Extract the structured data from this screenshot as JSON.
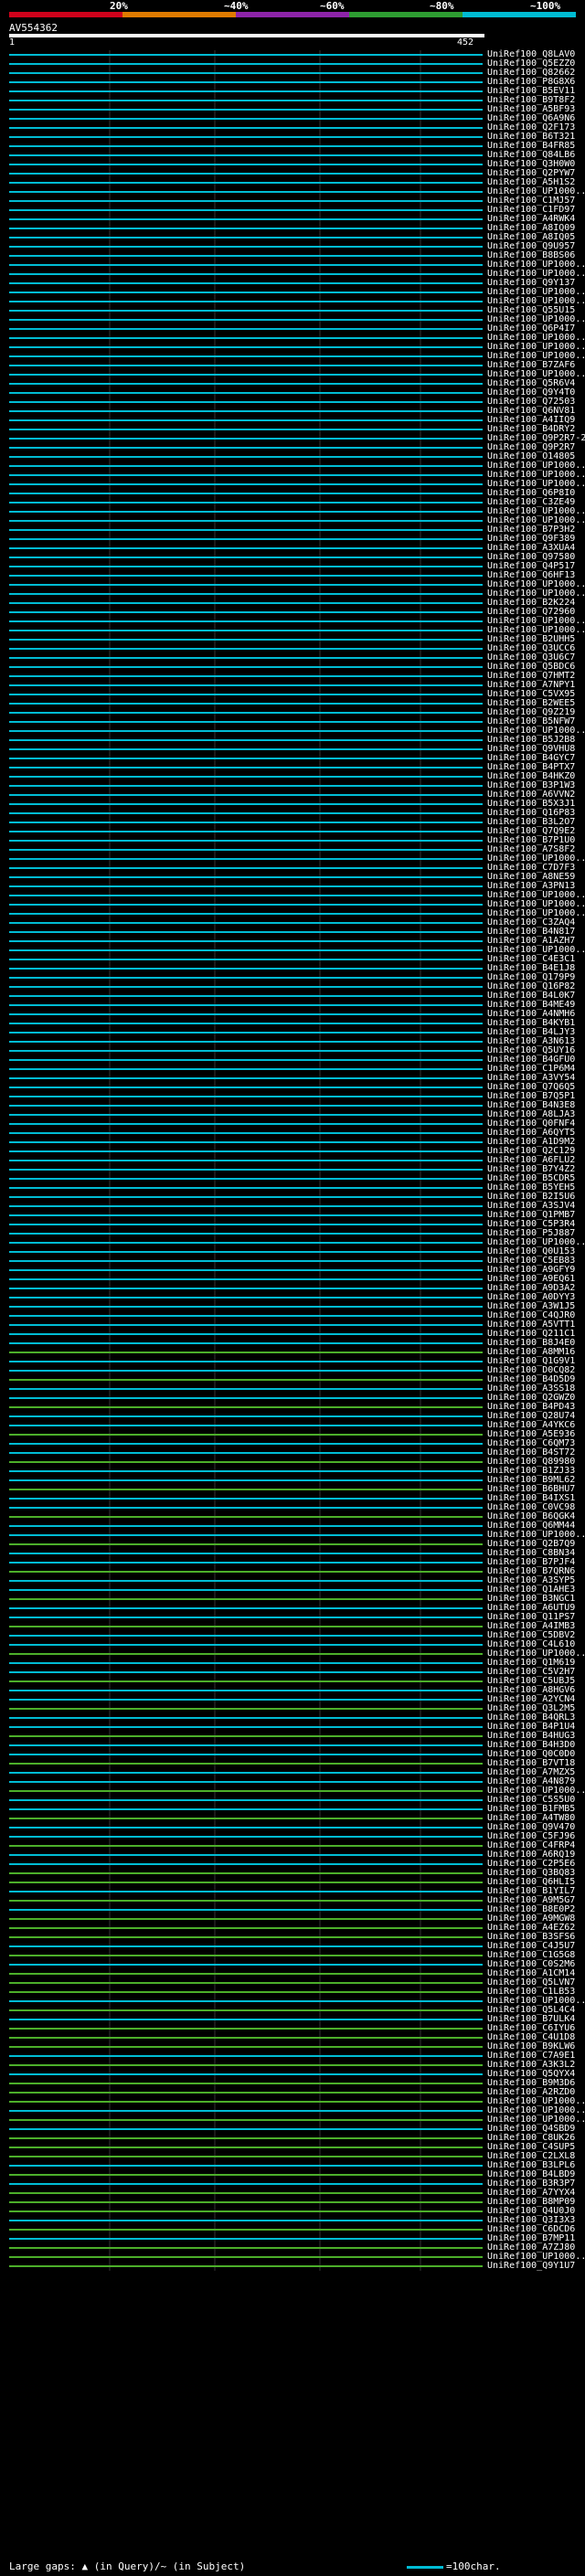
{
  "scale": {
    "labels": [
      "20%",
      "~40%",
      "~60%",
      "~80%",
      "~100%"
    ],
    "colors": [
      "#d0021b",
      "#e07b00",
      "#8e24aa",
      "#2e9e32",
      "#00bcd4"
    ]
  },
  "query": {
    "id": "AV554362",
    "start": "1",
    "end": "452"
  },
  "colors": {
    "cyan": "#00bcd4",
    "green": "#4caf2a",
    "query_line": "#ffffff"
  },
  "hits": [
    "UniRef100_Q8LAV0",
    "UniRef100_Q5EZZ0",
    "UniRef100_Q82662",
    "UniRef100_P8G8X6",
    "UniRef100_B5EV11",
    "UniRef100_B9T8F2",
    "UniRef100_A5BF93",
    "UniRef100_Q6A9N6",
    "UniRef100_Q2F173",
    "UniRef100_B6T321",
    "UniRef100_B4FR85",
    "UniRef100_Q84LB6",
    "UniRef100_Q3H0W0",
    "UniRef100_Q2PYW7",
    "UniRef100_A5H1S2",
    "UniRef100_UP1000...",
    "UniRef100_C1MJ57",
    "UniRef100_C1FD97",
    "UniRef100_A4RWK4",
    "UniRef100_A8IQ09",
    "UniRef100_A8IQ05",
    "UniRef100_Q9U957",
    "UniRef100_B8BS06",
    "UniRef100_UP1000...",
    "UniRef100_UP1000...",
    "UniRef100_Q9Y137",
    "UniRef100_UP1000...",
    "UniRef100_UP1000...",
    "UniRef100_Q55U15",
    "UniRef100_UP1000...",
    "UniRef100_Q6P4I7",
    "UniRef100_UP1000...",
    "UniRef100_UP1000...",
    "UniRef100_UP1000...",
    "UniRef100_B7ZAF6",
    "UniRef100_UP1000...",
    "UniRef100_Q5R6V4",
    "UniRef100_Q9Y4T0",
    "UniRef100_Q72503",
    "UniRef100_Q6NV81",
    "UniRef100_A4IIQ9",
    "UniRef100_B4DRY2",
    "UniRef100_Q9P2R7-2",
    "UniRef100_Q9P2R7",
    "UniRef100_O14805",
    "UniRef100_UP1000...",
    "UniRef100_UP1000...",
    "UniRef100_UP1000...",
    "UniRef100_Q6P8I0",
    "UniRef100_C3ZE49",
    "UniRef100_UP1000...",
    "UniRef100_UP1000...",
    "UniRef100_B7P3H2",
    "UniRef100_Q9F389",
    "UniRef100_A3XUA4",
    "UniRef100_Q97580",
    "UniRef100_Q4P517",
    "UniRef100_Q6HF13",
    "UniRef100_UP1000...",
    "UniRef100_UP1000...",
    "UniRef100_B2K224",
    "UniRef100_Q72960",
    "UniRef100_UP1000...",
    "UniRef100_UP1000...",
    "UniRef100_B2UHH5",
    "UniRef100_Q3UCC6",
    "UniRef100_Q3U6C7",
    "UniRef100_Q5BDC6",
    "UniRef100_Q7HMT2",
    "UniRef100_A7NPY1",
    "UniRef100_C5VX95",
    "UniRef100_B2WEE5",
    "UniRef100_Q9Z219",
    "UniRef100_B5NFW7",
    "UniRef100_UP1000...",
    "UniRef100_B5J2B8",
    "UniRef100_Q9VHU8",
    "UniRef100_B4GYC7",
    "UniRef100_B4PTX7",
    "UniRef100_B4HKZ0",
    "UniRef100_B3P1W3",
    "UniRef100_A6VVN2",
    "UniRef100_B5X3J1",
    "UniRef100_Q16P83",
    "UniRef100_B3L2O7",
    "UniRef100_Q7Q9E2",
    "UniRef100_B7P1U0",
    "UniRef100_A7S8F2",
    "UniRef100_UP1000...",
    "UniRef100_C7D7F3",
    "UniRef100_A8NE59",
    "UniRef100_A3PN13",
    "UniRef100_UP1000...",
    "UniRef100_UP1000...",
    "UniRef100_UP1000...",
    "UniRef100_C3ZAQ4",
    "UniRef100_B4N817",
    "UniRef100_A1AZH7",
    "UniRef100_UP1000...",
    "UniRef100_C4E3C1",
    "UniRef100_B4E1J8",
    "UniRef100_Q179P9",
    "UniRef100_Q16P82",
    "UniRef100_B4L0K7",
    "UniRef100_B4ME49",
    "UniRef100_A4NMH6",
    "UniRef100_B4KYB1",
    "UniRef100_B4LJY3",
    "UniRef100_A3N613",
    "UniRef100_Q5UY16",
    "UniRef100_B4GFU0",
    "UniRef100_C1P6M4",
    "UniRef100_A3VY54",
    "UniRef100_Q7Q6Q5",
    "UniRef100_B7Q5P1",
    "UniRef100_B4N3E8",
    "UniRef100_A8LJA3",
    "UniRef100_Q0FNF4",
    "UniRef100_A6QYT5",
    "UniRef100_A1D9M2",
    "UniRef100_Q2C129",
    "UniRef100_A6FLU2",
    "UniRef100_B7Y4Z2",
    "UniRef100_B5CDR5",
    "UniRef100_B5YEH5",
    "UniRef100_B2I5U6",
    "UniRef100_A3SJV4",
    "UniRef100_Q1PMB7",
    "UniRef100_C5P3R4",
    "UniRef100_P5J887",
    "UniRef100_UP1000...",
    "UniRef100_Q0U153",
    "UniRef100_C5EB83",
    "UniRef100_A9GFY9",
    "UniRef100_A9EQ61",
    "UniRef100_A9D3A2",
    "UniRef100_A0DYY3",
    "UniRef100_A3W1J5",
    "UniRef100_C4QJR0",
    "UniRef100_A5VTT1",
    "UniRef100_Q211C1",
    "UniRef100_B8J4E0",
    "UniRef100_A8MM16",
    "UniRef100_Q1G9V1",
    "UniRef100_D0CQ82",
    "UniRef100_B4D5D9",
    "UniRef100_A3SS18",
    "UniRef100_Q2GWZ0",
    "UniRef100_B4PD43",
    "UniRef100_Q28U74",
    "UniRef100_A4YKC6",
    "UniRef100_A5E936",
    "UniRef100_C6QM73",
    "UniRef100_B4ST72",
    "UniRef100_Q89980",
    "UniRef100_B1ZJ33",
    "UniRef100_B9ML62",
    "UniRef100_B6BHU7",
    "UniRef100_B4IXS1",
    "UniRef100_C0VC98",
    "UniRef100_B6QGK4",
    "UniRef100_Q6MM44",
    "UniRef100_UP1000...",
    "UniRef100_Q2B7Q9",
    "UniRef100_C8BN34",
    "UniRef100_B7PJF4",
    "UniRef100_B7QRN6",
    "UniRef100_A3SYP5",
    "UniRef100_Q1AHE3",
    "UniRef100_B3NGC1",
    "UniRef100_A6UTU9",
    "UniRef100_Q11PS7",
    "UniRef100_A4IMB3",
    "UniRef100_C5DBV2",
    "UniRef100_C4L610",
    "UniRef100_UP1000...",
    "UniRef100_Q1M619",
    "UniRef100_C5V2H7",
    "UniRef100_C5UBJ5",
    "UniRef100_A8HGV6",
    "UniRef100_A2YCN4",
    "UniRef100_Q3L2M5",
    "UniRef100_B4QRL3",
    "UniRef100_B4P1U4",
    "UniRef100_B4HUG3",
    "UniRef100_B4H3D0",
    "UniRef100_Q0C0D0",
    "UniRef100_B7VT18",
    "UniRef100_A7MZX5",
    "UniRef100_A4N879",
    "UniRef100_UP1000...",
    "UniRef100_C5S5U0",
    "UniRef100_B1FMB5",
    "UniRef100_A4TW80",
    "UniRef100_Q9V470",
    "UniRef100_C5FJ96",
    "UniRef100_C4FRP4",
    "UniRef100_A6RQ19",
    "UniRef100_C2P5E6",
    "UniRef100_Q3BQ83",
    "UniRef100_Q6HLI5",
    "UniRef100_B1YIL7",
    "UniRef100_A9M5G7",
    "UniRef100_B8E0P2",
    "UniRef100_A9MGW8",
    "UniRef100_A4EZ62",
    "UniRef100_B3SFS6",
    "UniRef100_C4J5U7",
    "UniRef100_C1G5G8",
    "UniRef100_C0S2M6",
    "UniRef100_A1CM14",
    "UniRef100_Q5LVN7",
    "UniRef100_C1LB53",
    "UniRef100_UP1000...",
    "UniRef100_Q5L4C4",
    "UniRef100_B7ULK4",
    "UniRef100_C6IYU6",
    "UniRef100_C4U1D8",
    "UniRef100_B9KLW6",
    "UniRef100_C7A9E1",
    "UniRef100_A3K3L2",
    "UniRef100_Q5QYX4",
    "UniRef100_B9M3D6",
    "UniRef100_A2RZD0",
    "UniRef100_UP1000...",
    "UniRef100_UP1000...",
    "UniRef100_UP1000...",
    "UniRef100_Q4SBD9",
    "UniRef100_C8UK26",
    "UniRef100_C4SUP5",
    "UniRef100_C2LXL8",
    "UniRef100_B3LPL6",
    "UniRef100_B4LBD9",
    "UniRef100_B3R3P7",
    "UniRef100_A7YYX4",
    "UniRef100_B8MP09",
    "UniRef100_Q4U0J0",
    "UniRef100_Q3I3X3",
    "UniRef100_C6DCD6",
    "UniRef100_B7MP11",
    "UniRef100_A7ZJ80",
    "UniRef100_UP1000...",
    "UniRef100_Q9Y1U7"
  ],
  "footer": {
    "gaps_text": "Large gaps: ▲ (in Query)/~ (in Subject)",
    "legend_text": "=100char."
  }
}
